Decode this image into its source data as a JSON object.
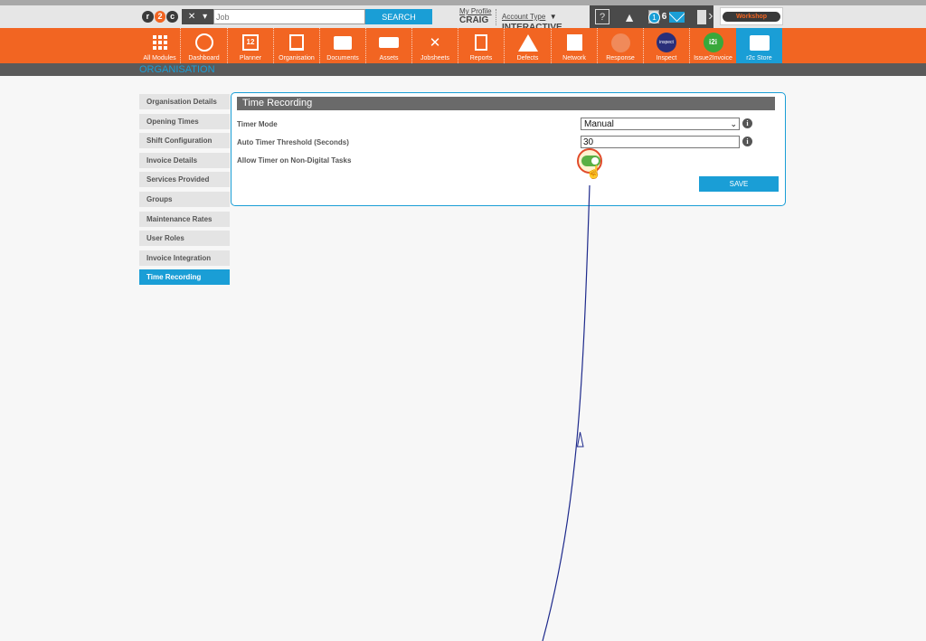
{
  "header": {
    "logo": "r2c",
    "search_placeholder": "Job",
    "search_button": "SEARCH",
    "profile_link": "My Profile",
    "profile_name": "CRAIG",
    "account_link": "Account Type",
    "account_value": "INTERACTIVE",
    "help_icon": "?",
    "notification_badge": "1",
    "message_count": "6",
    "workshop_label": "Workshop"
  },
  "modules": [
    {
      "label": "All Modules",
      "icon": "grid-icon"
    },
    {
      "label": "Dashboard",
      "icon": "dashboard-icon"
    },
    {
      "label": "Planner",
      "icon": "calendar-icon",
      "icon_text": "12"
    },
    {
      "label": "Organisation",
      "icon": "building-icon"
    },
    {
      "label": "Documents",
      "icon": "folder-icon"
    },
    {
      "label": "Assets",
      "icon": "truck-icon"
    },
    {
      "label": "Jobsheets",
      "icon": "tools-icon"
    },
    {
      "label": "Reports",
      "icon": "clipboard-icon"
    },
    {
      "label": "Defects",
      "icon": "warning-icon"
    },
    {
      "label": "Network",
      "icon": "id-card-icon"
    },
    {
      "label": "Response",
      "icon": "response-icon"
    },
    {
      "label": "Inspect",
      "icon": "inspect-icon",
      "icon_text": "inspect"
    },
    {
      "label": "Issue2Invoice",
      "icon": "i2i-icon",
      "icon_text": "i2i"
    },
    {
      "label": "r2c Store",
      "icon": "briefcase-icon"
    }
  ],
  "section_title": "ORGANISATION",
  "sidebar": {
    "items": [
      {
        "label": "Organisation Details"
      },
      {
        "label": "Opening Times"
      },
      {
        "label": "Shift Configuration"
      },
      {
        "label": "Invoice Details"
      },
      {
        "label": "Services Provided"
      },
      {
        "label": "Groups"
      },
      {
        "label": "Maintenance Rates"
      },
      {
        "label": "User Roles"
      },
      {
        "label": "Invoice Integration"
      },
      {
        "label": "Time Recording"
      }
    ],
    "active_index": 9
  },
  "panel": {
    "title": "Time Recording",
    "timer_mode_label": "Timer Mode",
    "timer_mode_value": "Manual",
    "threshold_label": "Auto Timer Threshold (Seconds)",
    "threshold_value": "30",
    "allow_timer_label": "Allow Timer on Non-Digital Tasks",
    "allow_timer_on": true,
    "save_label": "SAVE",
    "info_icon": "i"
  },
  "colors": {
    "brand_orange": "#f26522",
    "accent_blue": "#1a9ed6",
    "toggle_green": "#5ab045",
    "annotation_navy": "#1e2a8c"
  }
}
